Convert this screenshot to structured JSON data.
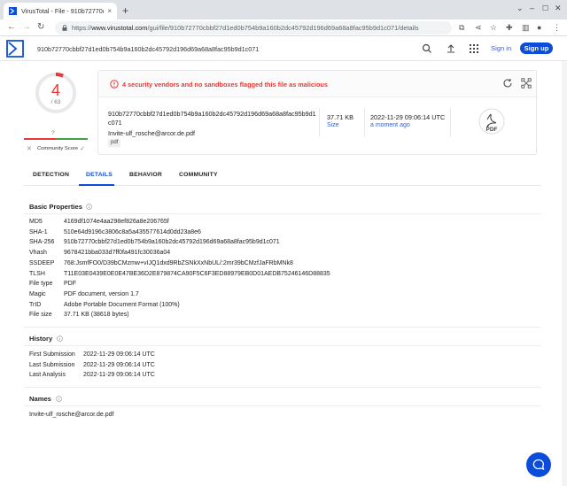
{
  "browser": {
    "tab_title": "VirusTotal - File - 910b72770c",
    "tab_close": "×",
    "new_tab": "+",
    "url_prefix": "https://",
    "url_domain": "www.virustotal.com",
    "url_path": "/gui/file/910b72770cbbf27d1ed0b754b9a160b2dc45792d196d69a68a8fac95b9d1c071/details"
  },
  "header": {
    "search_value": "910b72770cbbf27d1ed0b754b9a160b2dc45792d196d69a68a8fac95b9d1c071",
    "signin_label": "Sign in",
    "signup_label": "Sign up"
  },
  "score": {
    "detections": "4",
    "total": "/ 63",
    "detection_fraction": 0.0635,
    "community_score_value": "?",
    "community_label": "Community Score",
    "accent": "#e53935"
  },
  "summary": {
    "alert": "4 security vendors and no sandboxes flagged this file as malicious",
    "hash_line1": "910b72770cbbf27d1ed0b754b9a160b2dc45792d196d69a68a8fac95b9d1",
    "hash_line2": "c071",
    "file_name": "Invite-ulf_rosche@arcor.de.pdf",
    "tag": "pdf",
    "size": "37.71 KB",
    "size_label": "Size",
    "date": "2022-11-29 09:06:14 UTC",
    "date_label": "a moment ago",
    "file_type_icon_label": "PDF"
  },
  "tabs": [
    "DETECTION",
    "DETAILS",
    "BEHAVIOR",
    "COMMUNITY"
  ],
  "basic_properties": {
    "title": "Basic Properties",
    "rows": [
      {
        "k": "MD5",
        "v": "4169df1074e4aa298ef826a8e206765f"
      },
      {
        "k": "SHA-1",
        "v": "510e64d9196c3806c8a5a435577614d0dd23a8e6"
      },
      {
        "k": "SHA-256",
        "v": "910b72770cbbf27d1ed0b754b9a160b2dc45792d196d69a68a8fac95b9d1c071"
      },
      {
        "k": "Vhash",
        "v": "9678421bba033d7ff0fa491fc30036a04"
      },
      {
        "k": "SSDEEP",
        "v": "768:JsmfFO0/D39bCMzmw+vIJQ1dxd9RbZSNkXxNbUL/:2mr39bCMzfJaFRbMNk8"
      },
      {
        "k": "TLSH",
        "v": "T11E03E0439E0E0E47BE36D2E879874CA90F5C6F3ED88979EB0D01AEDB75246146D88835"
      },
      {
        "k": "File type",
        "v": "PDF"
      },
      {
        "k": "Magic",
        "v": "PDF document, version 1.7"
      },
      {
        "k": "TrID",
        "v": "Adobe Portable Document Format (100%)"
      },
      {
        "k": "File size",
        "v": "37.71 KB (38618 bytes)"
      }
    ]
  },
  "history": {
    "title": "History",
    "rows": [
      {
        "k": "First Submission",
        "v": "2022-11-29 09:06:14 UTC"
      },
      {
        "k": "Last Submission",
        "v": "2022-11-29 09:06:14 UTC"
      },
      {
        "k": "Last Analysis",
        "v": "2022-11-29 09:06:14 UTC"
      }
    ]
  },
  "names": {
    "title": "Names",
    "rows": [
      "Invite-ulf_rosche@arcor.de.pdf"
    ]
  }
}
